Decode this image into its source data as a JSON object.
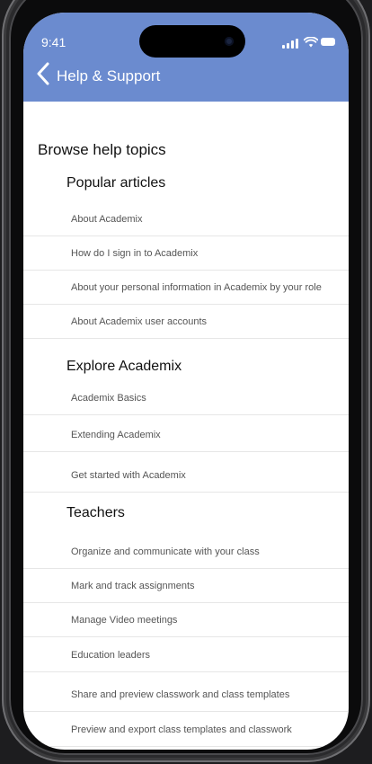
{
  "status_bar": {
    "time": "9:41"
  },
  "header": {
    "title": "Help & Support"
  },
  "browse": {
    "heading": "Browse help topics"
  },
  "sections": [
    {
      "title": "Popular articles",
      "items": [
        "About Academix",
        "How do I sign in to Academix",
        "About your personal information in Academix by your role",
        "About Academix user accounts"
      ]
    },
    {
      "title": "Explore Academix",
      "items": [
        "Academix Basics",
        "Extending Academix",
        "Get started with Academix"
      ]
    },
    {
      "title": "Teachers",
      "items": [
        "Organize and  communicate with your class",
        "Mark and track assignments",
        "Manage Video meetings",
        "Education leaders",
        "Share and preview classwork and class templates",
        "Preview and export class templates and classwork"
      ]
    }
  ],
  "colors": {
    "header": "#6b8bcf",
    "background": "#ffffff",
    "divider": "#e6e6e6"
  }
}
